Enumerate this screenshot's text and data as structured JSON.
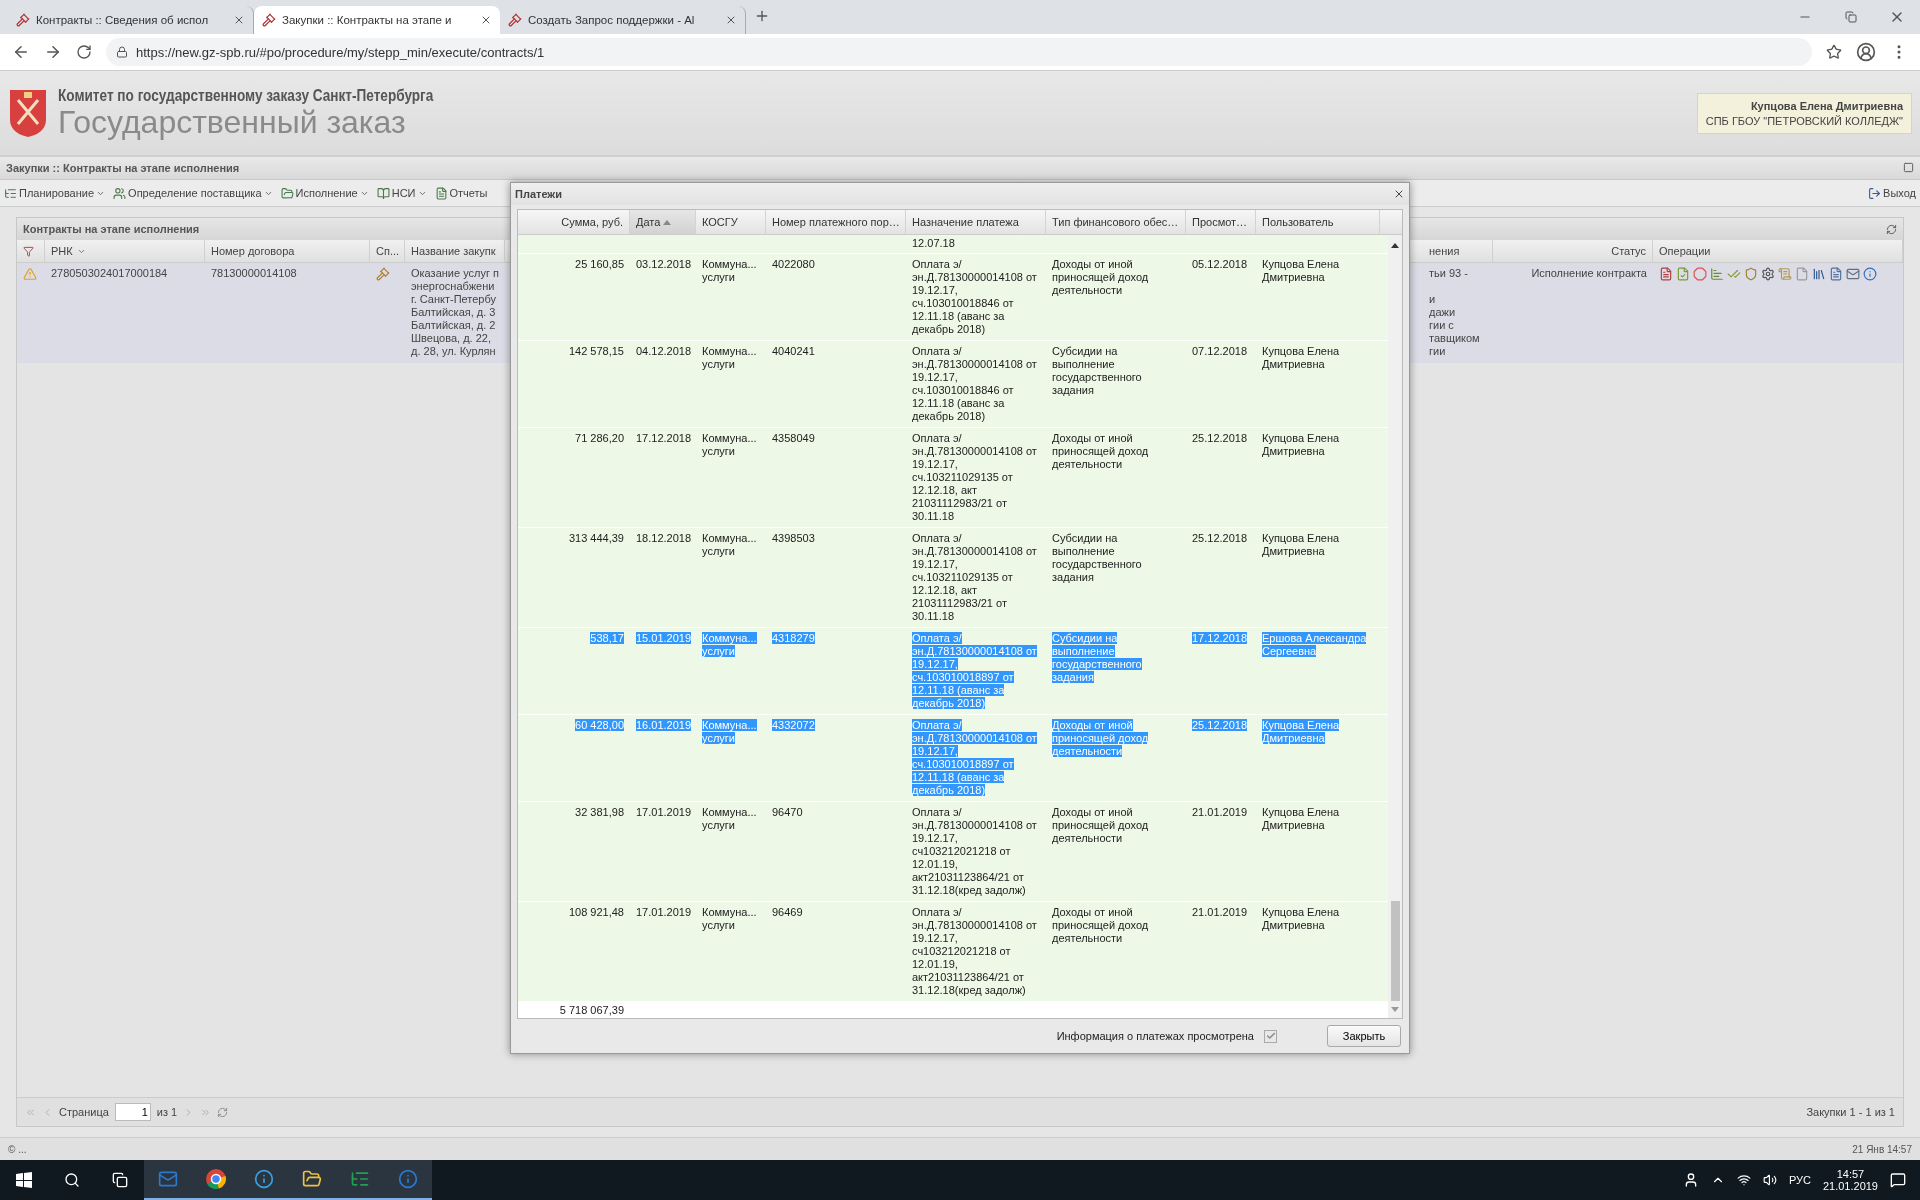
{
  "browser": {
    "tabs": [
      {
        "title": "Контракты :: Сведения об испол",
        "selected": false
      },
      {
        "title": "Закупки :: Контракты на этапе и",
        "selected": true
      },
      {
        "title": "Создать Запрос поддержки - Al",
        "selected": false
      }
    ],
    "url": "https://new.gz-spb.ru/#po/procedure/my/stepp_min/execute/contracts/1"
  },
  "header": {
    "org": "Комитет по государственному заказу Санкт-Петербурга",
    "title": "Государственный заказ",
    "user_name": "Купцова Елена Дмитриевна",
    "user_org": "СПБ ГБОУ \"ПЕТРОВСКИЙ КОЛЛЕДЖ\""
  },
  "panel": {
    "title": "Закупки :: Контракты на этапе исполнения"
  },
  "toolbar": {
    "items": [
      {
        "label": "Планирование",
        "dropdown": true
      },
      {
        "label": "Определение поставщика",
        "dropdown": true
      },
      {
        "label": "Исполнение",
        "dropdown": true
      },
      {
        "label": "НСИ",
        "dropdown": true
      },
      {
        "label": "Отчеты",
        "dropdown": false
      }
    ],
    "exit": "Выход"
  },
  "grid": {
    "title": "Контракты на этапе исполнения",
    "left_columns": [
      "РНК",
      "Номер договора",
      "Сп...",
      "Название закупк"
    ],
    "right_columns": [
      "нения",
      "Статус",
      "Операции"
    ],
    "row": {
      "rnk": "2780503024017000184",
      "contract": "78130000014108",
      "name": "Оказание услуг п\nэнергоснабжени\nг. Санкт-Петербу\nБалтийская, д. 3\nБалтийская, д. 2\nШвецова, д. 22,\nд. 28, ул. Курлян",
      "basis": "тьи 93 -\n\nи\nдажи\nгии с\nтавщиком\nгии",
      "status": "Исполнение контракта"
    }
  },
  "pager": {
    "page_label": "Страница",
    "page": "1",
    "of": "из 1",
    "summary": "Закупки 1 - 1 из 1"
  },
  "status_bar": {
    "left": "© ...",
    "right": "21 Янв 14:57"
  },
  "dialog": {
    "title": "Платежи",
    "columns": [
      {
        "label": "Сумма, руб.",
        "sorted": false
      },
      {
        "label": "Дата",
        "sorted": true
      },
      {
        "label": "КОСГУ",
        "sorted": false
      },
      {
        "label": "Номер платежного пор…",
        "sorted": false
      },
      {
        "label": "Назначение платежа",
        "sorted": false
      },
      {
        "label": "Тип финансового обес…",
        "sorted": false
      },
      {
        "label": "Просмот…",
        "sorted": false
      },
      {
        "label": "Пользователь",
        "sorted": false
      }
    ],
    "partial_row": {
      "purpose": "12.07.18"
    },
    "rows": [
      {
        "amount": "25 160,85",
        "date": "03.12.2018",
        "kosgu": "Коммуна...\nуслуги",
        "number": "4022080",
        "purpose": "Оплата э/\nэн.Д.78130000014108 от\n19.12.17,\nсч.103010018846 от\n12.11.18 (аванс за\nдекабрь 2018)",
        "fin_type": "Доходы от иной\nприносящей доход\nдеятельности",
        "viewed": "05.12.2018",
        "user": "Купцова Елена\nДмитриевна",
        "selected": false
      },
      {
        "amount": "142 578,15",
        "date": "04.12.2018",
        "kosgu": "Коммуна...\nуслуги",
        "number": "4040241",
        "purpose": "Оплата э/\nэн.Д.78130000014108 от\n19.12.17,\nсч.103010018846 от\n12.11.18 (аванс за\nдекабрь 2018)",
        "fin_type": "Субсидии на\nвыполнение\nгосударственного\nзадания",
        "viewed": "07.12.2018",
        "user": "Купцова Елена\nДмитриевна",
        "selected": false
      },
      {
        "amount": "71 286,20",
        "date": "17.12.2018",
        "kosgu": "Коммуна...\nуслуги",
        "number": "4358049",
        "purpose": "Оплата э/\nэн.Д.78130000014108 от\n19.12.17,\nсч.103211029135 от\n12.12.18, акт\n21031112983/21 от\n30.11.18",
        "fin_type": "Доходы от иной\nприносящей доход\nдеятельности",
        "viewed": "25.12.2018",
        "user": "Купцова Елена\nДмитриевна",
        "selected": false
      },
      {
        "amount": "313 444,39",
        "date": "18.12.2018",
        "kosgu": "Коммуна...\nуслуги",
        "number": "4398503",
        "purpose": "Оплата э/\nэн.Д.78130000014108 от\n19.12.17,\nсч.103211029135 от\n12.12.18, акт\n21031112983/21 от\n30.11.18",
        "fin_type": "Субсидии на\nвыполнение\nгосударственного\nзадания",
        "viewed": "25.12.2018",
        "user": "Купцова Елена\nДмитриевна",
        "selected": false
      },
      {
        "amount": "538,17",
        "date": "15.01.2019",
        "kosgu": "Коммуна...\nуслуги",
        "number": "4318279",
        "purpose": "Оплата э/\nэн.Д.78130000014108 от\n19.12.17,\nсч.103010018897 от\n12.11.18 (аванс за\nдекабрь 2018)",
        "fin_type": "Субсидии на\nвыполнение\nгосударственного\nзадания",
        "viewed": "17.12.2018",
        "user": "Ершова Александра\nСергеевна",
        "selected": true
      },
      {
        "amount": "60 428,00",
        "date": "16.01.2019",
        "kosgu": "Коммуна...\nуслуги",
        "number": "4332072",
        "purpose": "Оплата э/\nэн.Д.78130000014108 от\n19.12.17,\nсч.103010018897 от\n12.11.18 (аванс за\nдекабрь 2018)",
        "fin_type": "Доходы от иной\nприносящей доход\nдеятельности",
        "viewed": "25.12.2018",
        "user": "Купцова Елена\nДмитриевна",
        "selected": true
      },
      {
        "amount": "32 381,98",
        "date": "17.01.2019",
        "kosgu": "Коммуна...\nуслуги",
        "number": "96470",
        "purpose": "Оплата э/\nэн.Д.78130000014108 от\n19.12.17,\nсч103212021218 от\n12.01.19,\nакт21031123864/21 от\n31.12.18(кред задолж)",
        "fin_type": "Доходы от иной\nприносящей доход\nдеятельности",
        "viewed": "21.01.2019",
        "user": "Купцова Елена\nДмитриевна",
        "selected": false
      },
      {
        "amount": "108 921,48",
        "date": "17.01.2019",
        "kosgu": "Коммуна...\nуслуги",
        "number": "96469",
        "purpose": "Оплата э/\nэн.Д.78130000014108 от\n19.12.17,\nсч103212021218 от\n12.01.19,\nакт21031123864/21 от\n31.12.18(кред задолж)",
        "fin_type": "Доходы от иной\nприносящей доход\nдеятельности",
        "viewed": "21.01.2019",
        "user": "Купцова Елена\nДмитриевна",
        "selected": false
      }
    ],
    "total": "5 718 067,39",
    "viewed_label": "Информация о платежах просмотрена",
    "viewed_checked": true,
    "close_button": "Закрыть"
  },
  "taskbar": {
    "language": "РУС",
    "time": "14:57",
    "date": "21.01.2019"
  }
}
